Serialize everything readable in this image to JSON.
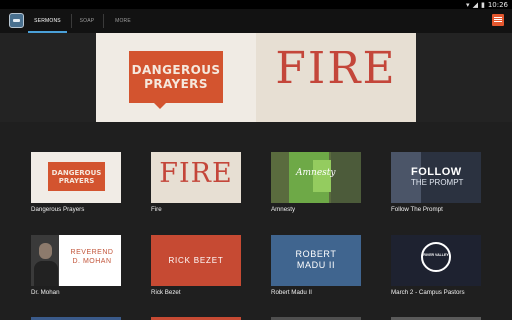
{
  "status_bar": {
    "time": "10:26"
  },
  "tabs": [
    {
      "label": "SERMONS",
      "active": true
    },
    {
      "label": "SOAP",
      "active": false
    },
    {
      "label": "MORE",
      "active": false
    }
  ],
  "hero": {
    "left_line1": "DANGEROUS",
    "left_line2": "PRAYERS",
    "right_title": "FIRE"
  },
  "grid": [
    {
      "label": "Dangerous Prayers",
      "thumb": {
        "line1": "DANGEROUS",
        "line2": "PRAYERS"
      }
    },
    {
      "label": "Fire",
      "thumb": {
        "title": "FIRE"
      }
    },
    {
      "label": "Amnesty",
      "thumb": {
        "title": "Amnesty"
      }
    },
    {
      "label": "Follow The Prompt",
      "thumb": {
        "line1": "FOLLOW",
        "line2": "THE PROMPT"
      }
    },
    {
      "label": "Dr. Mohan",
      "thumb": {
        "line1": "REVEREND",
        "line2": "D. MOHAN"
      }
    },
    {
      "label": "Rick Bezet",
      "thumb": {
        "title": "RICK BEZET"
      }
    },
    {
      "label": "Robert Madu II",
      "thumb": {
        "line1": "ROBERT",
        "line2": "MADU II"
      }
    },
    {
      "label": "March 2 - Campus Pastors",
      "thumb": {
        "title": "RIVER VALLEY"
      }
    }
  ],
  "colors": {
    "accent": "#4aa0d8",
    "appbar": "#121212",
    "background": "#1f1f1f"
  }
}
